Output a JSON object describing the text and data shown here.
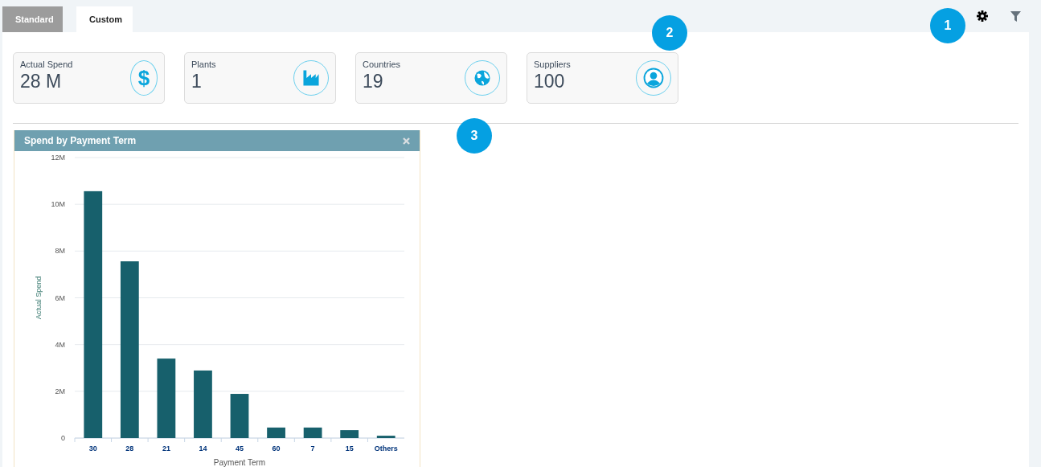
{
  "tabs": [
    {
      "label": "Standard",
      "selected": false
    },
    {
      "label": "Custom",
      "selected": true
    }
  ],
  "kpis": [
    {
      "label": "Actual Spend",
      "value": "28 M",
      "kind": "currency",
      "symbol": "$"
    },
    {
      "label": "Plants",
      "value": "1",
      "kind": "factory"
    },
    {
      "label": "Countries",
      "value": "19",
      "kind": "globe"
    },
    {
      "label": "Suppliers",
      "value": "100",
      "kind": "person"
    }
  ],
  "callouts": [
    "1",
    "2",
    "3"
  ],
  "panel": {
    "title": "Spend by Payment Term",
    "chart_data": {
      "type": "bar",
      "xlabel": "Payment Term",
      "ylabel": "Actual Spend",
      "categories": [
        "30",
        "28",
        "21",
        "14",
        "45",
        "60",
        "7",
        "15",
        "Others"
      ],
      "grid": true,
      "series": [
        {
          "color": "#17606c",
          "values": [
            10560000,
            7560000,
            3400000,
            2890000,
            1890000,
            450000,
            450000,
            340000,
            100000
          ]
        }
      ],
      "ylim": [
        0,
        12000000
      ],
      "yticks": [
        {
          "value": 0,
          "label": "0"
        },
        {
          "value": 2000000,
          "label": "2M"
        },
        {
          "value": 4000000,
          "label": "4M"
        },
        {
          "value": 6000000,
          "label": "6M"
        },
        {
          "value": 8000000,
          "label": "8M"
        },
        {
          "value": 10000000,
          "label": "10M"
        },
        {
          "value": 12000000,
          "label": "12M"
        }
      ]
    }
  }
}
